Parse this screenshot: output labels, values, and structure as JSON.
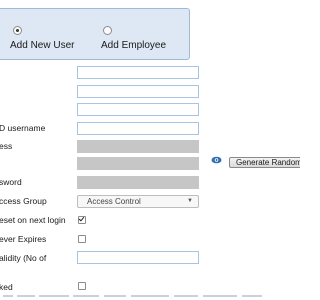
{
  "mode_selector": {
    "options": [
      {
        "label": "Add New User",
        "selected": true
      },
      {
        "label": "Add Employee",
        "selected": false
      }
    ]
  },
  "form": {
    "labels": {
      "ad_username": "D username",
      "ess": "ess",
      "password": "sword",
      "access_group": "ccess Group",
      "reset_next_login": "eset on next login",
      "never_expires": "ever Expires",
      "validity": "alidity (No of",
      "locked": "ked"
    },
    "access_group_value": "Access Control",
    "generate_button_label": "Generate Random",
    "reset_on_next_login_checked": true,
    "never_expires_checked": false,
    "locked_checked": false
  },
  "colors": {
    "panel_bg": "#dde8f4",
    "input_border": "#a9c4e0",
    "disabled_input": "#c6c6c6"
  }
}
